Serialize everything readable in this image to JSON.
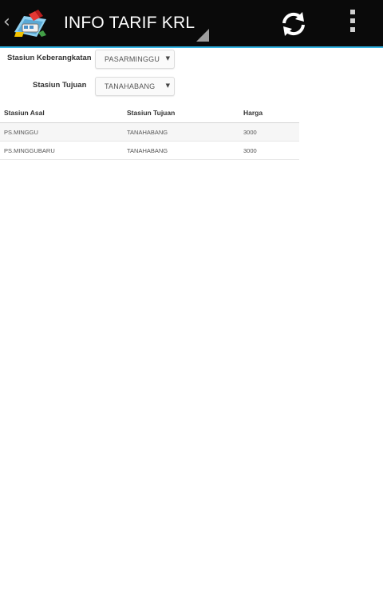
{
  "actionbar": {
    "title": "INFO TARIF KRL",
    "colors": {
      "background": "#0a0a0a",
      "accent": "#33b5e5"
    },
    "icons": {
      "up": "chevron-left-icon",
      "app": "train-map-icon",
      "refresh": "refresh-icon",
      "overflow": "overflow-menu-icon"
    }
  },
  "form": {
    "departure": {
      "label": "Stasiun Keberangkatan",
      "value": "PASARMINGGU"
    },
    "destination": {
      "label": "Stasiun Tujuan",
      "value": "TANAHABANG"
    }
  },
  "table": {
    "columns": [
      "Stasiun Asal",
      "Stasiun Tujuan",
      "Harga"
    ],
    "rows": [
      [
        "PS.MINGGU",
        "TANAHABANG",
        "3000"
      ],
      [
        "PS.MINGGUBARU",
        "TANAHABANG",
        "3000"
      ]
    ]
  }
}
